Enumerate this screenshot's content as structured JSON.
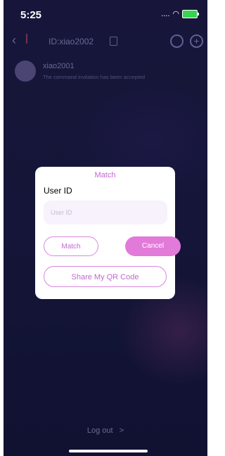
{
  "status_bar": {
    "time": "5:25",
    "signal": "....",
    "wifi_icon": "wifi-icon",
    "battery_icon": "battery-charging-icon"
  },
  "header": {
    "title": "ID:xiao2002"
  },
  "contact": {
    "name": "xiao2001",
    "message": "The command invitation has been accepted"
  },
  "footer": {
    "logout_label": "Log out",
    "logout_chevron": ">"
  },
  "dialog": {
    "title": "Match",
    "field_label": "User ID",
    "input_placeholder": "User ID",
    "match_label": "Match",
    "cancel_label": "Cancel",
    "share_label": "Share My QR Code"
  },
  "colors": {
    "accent": "#e27ad9",
    "accent_text": "#c266d3",
    "background": "#15163a"
  }
}
